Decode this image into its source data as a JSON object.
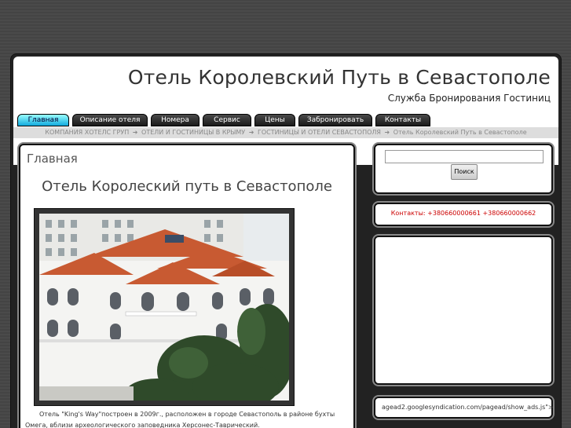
{
  "header": {
    "title": "Отель Королевский Путь в Севастополе",
    "subtitle": "Служба Бронирования Гостиниц"
  },
  "nav": {
    "items": [
      {
        "label": "Главная"
      },
      {
        "label": "Описание отеля"
      },
      {
        "label": "Номера"
      },
      {
        "label": "Сервис"
      },
      {
        "label": "Цены"
      },
      {
        "label": "Забронировать"
      },
      {
        "label": "Контакты"
      }
    ]
  },
  "breadcrumb": {
    "items": [
      "КОМПАНИЯ ХОТЕЛС ГРУП",
      "ОТЕЛИ И ГОСТИНИЦЫ В КРЫМУ",
      "ГОСТИНИЦЫ И ОТЕЛИ СЕВАСТОПОЛЯ",
      "Отель Королевский Путь в Севастополе"
    ],
    "separator": "➜"
  },
  "main": {
    "page_heading": "Главная",
    "article_title": "Отель Королеский путь в Севастополе",
    "article_text": "Отель \"King's Way\"построен в 2009г., расположен в городе Севастополь в районе бухты Омега, вблизи археологического заповедника Херсонес-Таврический."
  },
  "sidebar": {
    "search": {
      "input_value": "",
      "button_label": "Поиск"
    },
    "contacts": "Контакты: +380660000661 +380660000662",
    "ad_url": "agead2.googlesyndication.com/pagead/show_ads.js\">"
  },
  "colors": {
    "active_tab": "#1ad",
    "contacts_text": "#c00",
    "roof": "#c85a32"
  }
}
